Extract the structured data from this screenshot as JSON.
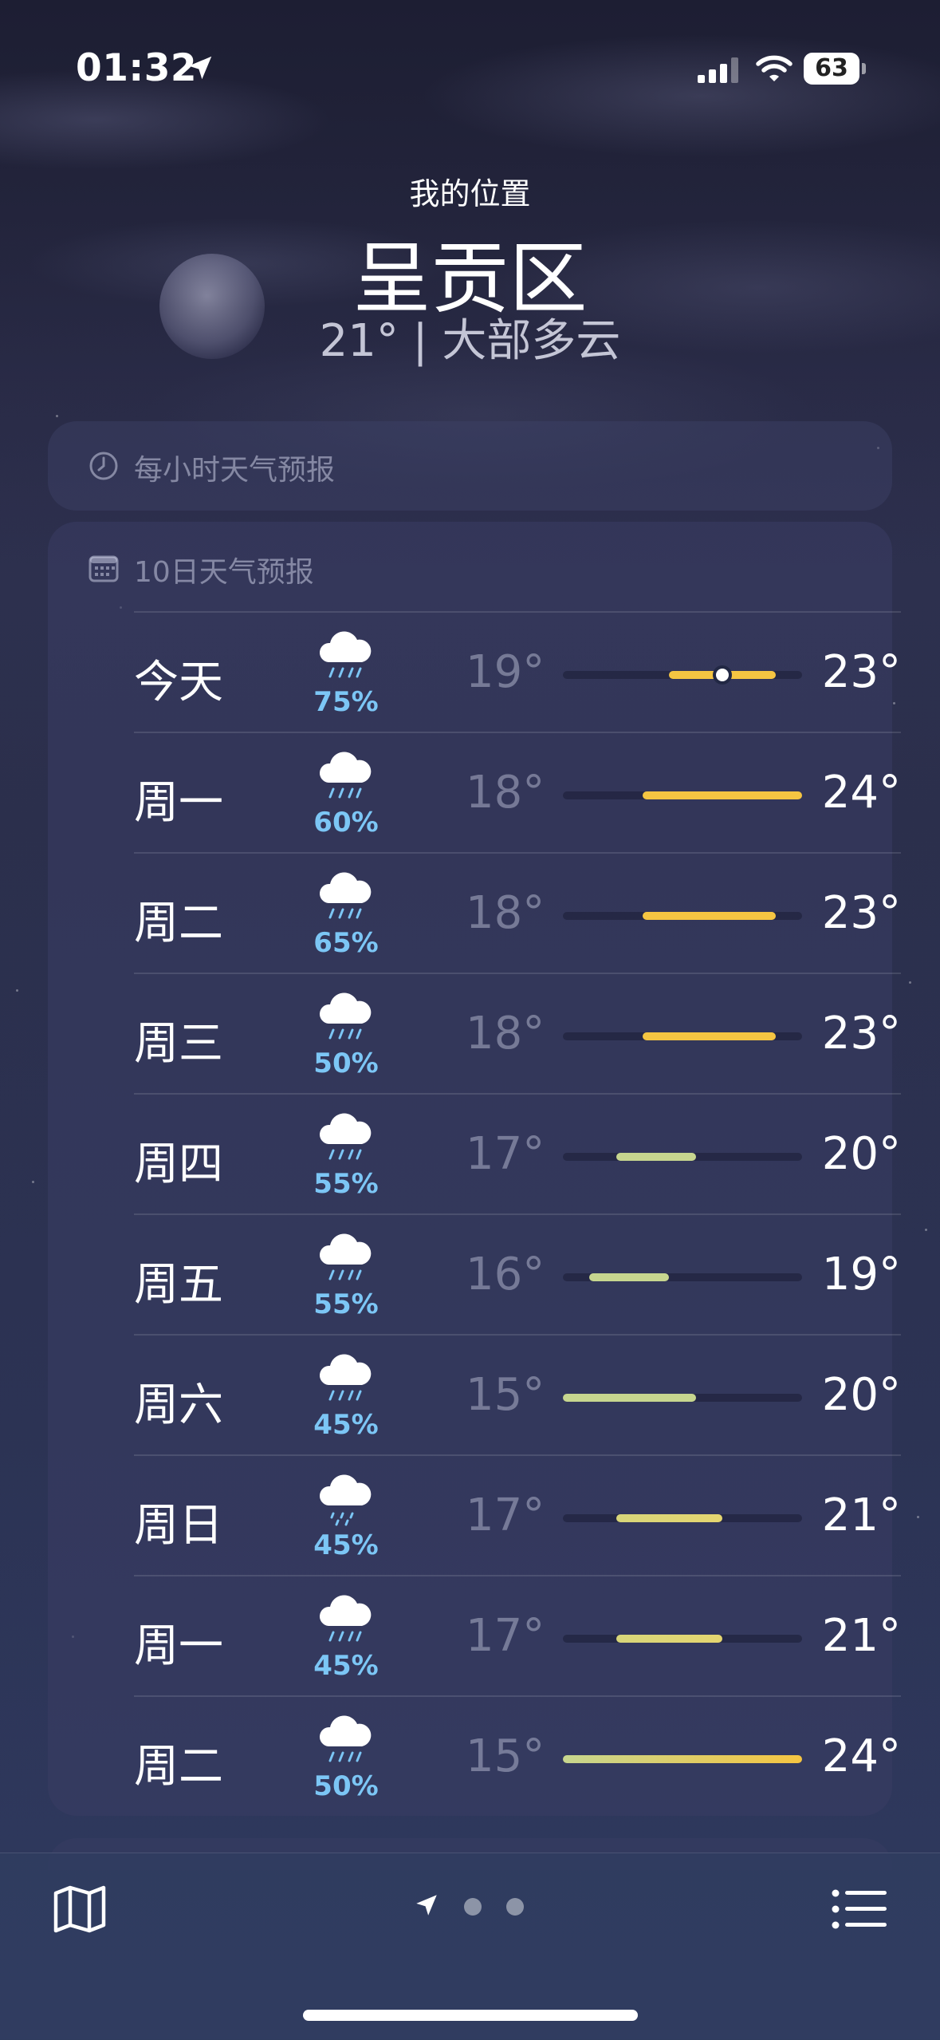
{
  "status_bar": {
    "time": "01:32",
    "battery": "63"
  },
  "header": {
    "location_label": "我的位置",
    "city": "呈贡区",
    "summary": "21° | 大部多云"
  },
  "hourly_card": {
    "title": "每小时天气预报",
    "icon": "clock-icon"
  },
  "ten_day_card": {
    "title": "10日天气预报",
    "icon": "calendar-icon",
    "range": [
      15,
      24
    ],
    "current_temp": 21,
    "days": [
      {
        "day": "今天",
        "precip": "75%",
        "low": "19°",
        "high": "23°",
        "low_v": 19,
        "high_v": 23,
        "icon": "cloud-rain-icon"
      },
      {
        "day": "周一",
        "precip": "60%",
        "low": "18°",
        "high": "24°",
        "low_v": 18,
        "high_v": 24,
        "icon": "cloud-rain-icon"
      },
      {
        "day": "周二",
        "precip": "65%",
        "low": "18°",
        "high": "23°",
        "low_v": 18,
        "high_v": 23,
        "icon": "cloud-rain-icon"
      },
      {
        "day": "周三",
        "precip": "50%",
        "low": "18°",
        "high": "23°",
        "low_v": 18,
        "high_v": 23,
        "icon": "cloud-rain-icon"
      },
      {
        "day": "周四",
        "precip": "55%",
        "low": "17°",
        "high": "20°",
        "low_v": 17,
        "high_v": 20,
        "icon": "cloud-rain-icon"
      },
      {
        "day": "周五",
        "precip": "55%",
        "low": "16°",
        "high": "19°",
        "low_v": 16,
        "high_v": 19,
        "icon": "cloud-rain-icon"
      },
      {
        "day": "周六",
        "precip": "45%",
        "low": "15°",
        "high": "20°",
        "low_v": 15,
        "high_v": 20,
        "icon": "cloud-rain-icon"
      },
      {
        "day": "周日",
        "precip": "45%",
        "low": "17°",
        "high": "21°",
        "low_v": 17,
        "high_v": 21,
        "icon": "cloud-drizzle-icon"
      },
      {
        "day": "周一",
        "precip": "45%",
        "low": "17°",
        "high": "21°",
        "low_v": 17,
        "high_v": 21,
        "icon": "cloud-rain-icon"
      },
      {
        "day": "周二",
        "precip": "50%",
        "low": "15°",
        "high": "24°",
        "low_v": 15,
        "high_v": 24,
        "icon": "cloud-rain-icon"
      }
    ]
  },
  "colors": {
    "precip": "#7cc6f5",
    "bar_cool": "#c7d68f",
    "bar_warm": "#f5c542"
  },
  "toolbar": {
    "left_icon": "map-icon",
    "right_icon": "list-icon",
    "pages": 3,
    "current_page": 0
  }
}
